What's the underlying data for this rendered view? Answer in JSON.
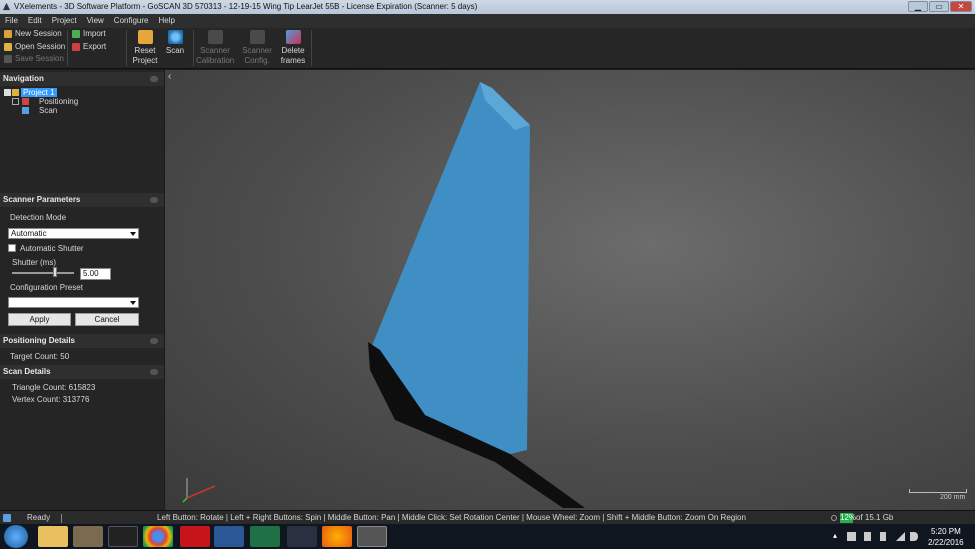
{
  "window": {
    "title": "VXelements - 3D Software Platform - GoSCAN 3D 570313 - 12-19-15 Wing Tip LearJet 55B - License Expiration (Scanner: 5 days)",
    "minimize": "▁",
    "maximize": "▭",
    "close": "✕"
  },
  "menu": [
    "File",
    "Edit",
    "Project",
    "View",
    "Configure",
    "Help"
  ],
  "ribbon": {
    "new_session": "New Session",
    "open_session": "Open Session",
    "save_session": "Save Session",
    "import": "Import",
    "export": "Export",
    "reset_project_1": "Reset",
    "reset_project_2": "Project",
    "scan": "Scan",
    "scanner_calibration_1": "Scanner",
    "scanner_calibration_2": "Calibration",
    "scanner_config_1": "Scanner",
    "scanner_config_2": "Config.",
    "delete_frames_1": "Delete",
    "delete_frames_2": "frames"
  },
  "navigation": {
    "header": "Navigation",
    "project": "Project 1",
    "positioning": "Positioning",
    "scan": "Scan",
    "collapse": "‹"
  },
  "scanner_parameters": {
    "header": "Scanner Parameters",
    "detection_mode_label": "Detection Mode",
    "detection_mode_value": "Automatic",
    "automatic_shutter": "Automatic Shutter",
    "automatic_shutter_checked": false,
    "shutter_label": "Shutter (ms)",
    "shutter_value": "5.00",
    "shutter_slider_fraction": 0.7,
    "config_preset_label": "Configuration Preset",
    "config_preset_value": "",
    "apply": "Apply",
    "cancel": "Cancel"
  },
  "positioning_details": {
    "header": "Positioning Details",
    "target_count": "Target Count: 50"
  },
  "scan_details": {
    "header": "Scan Details",
    "triangle_count": "Triangle Count: 615823",
    "vertex_count": "Vertex Count: 313776"
  },
  "viewport": {
    "scale": "200 mm",
    "model_color": "#3f8fc4"
  },
  "status": {
    "state": "Ready",
    "hints": "Left Button: Rotate  |  Left + Right Buttons: Spin  |  Middle Button: Pan  |  Middle Click: Set Rotation Center  |  Mouse Wheel: Zoom  |  Shift + Middle Button: Zoom On Region",
    "memory_percent": "12%",
    "memory_total": "of 15.1 Gb"
  },
  "taskbar": {
    "time": "5:20 PM",
    "date": "2/22/2016"
  },
  "colors": {
    "accent": "#3399ff",
    "memory": "#22b14c"
  }
}
